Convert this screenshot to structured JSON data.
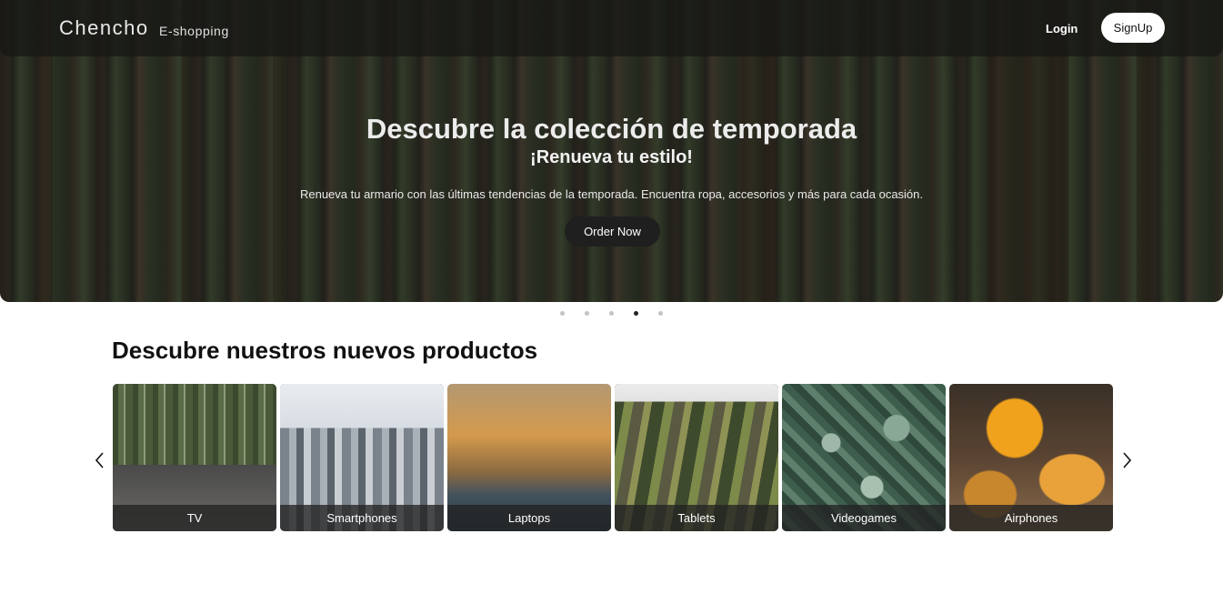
{
  "navbar": {
    "brand": "Chencho",
    "brand_sub": "E-shopping",
    "login_label": "Login",
    "signup_label": "SignUp"
  },
  "hero": {
    "title": "Descubre la colección de temporada",
    "subtitle": "¡Renueva tu estilo!",
    "text": "Renueva tu armario con las últimas tendencias de la temporada. Encuentra ropa, accesorios y más para cada ocasión.",
    "cta_label": "Order Now"
  },
  "carousel": {
    "slide_count": 5,
    "active_slide": 4
  },
  "products": {
    "title": "Descubre nuestros nuevos productos",
    "prev_icon": "chevron-left-icon",
    "next_icon": "chevron-right-icon",
    "items": [
      {
        "label": "TV"
      },
      {
        "label": "Smartphones"
      },
      {
        "label": "Laptops"
      },
      {
        "label": "Tablets"
      },
      {
        "label": "Videogames"
      },
      {
        "label": "Airphones"
      }
    ]
  }
}
